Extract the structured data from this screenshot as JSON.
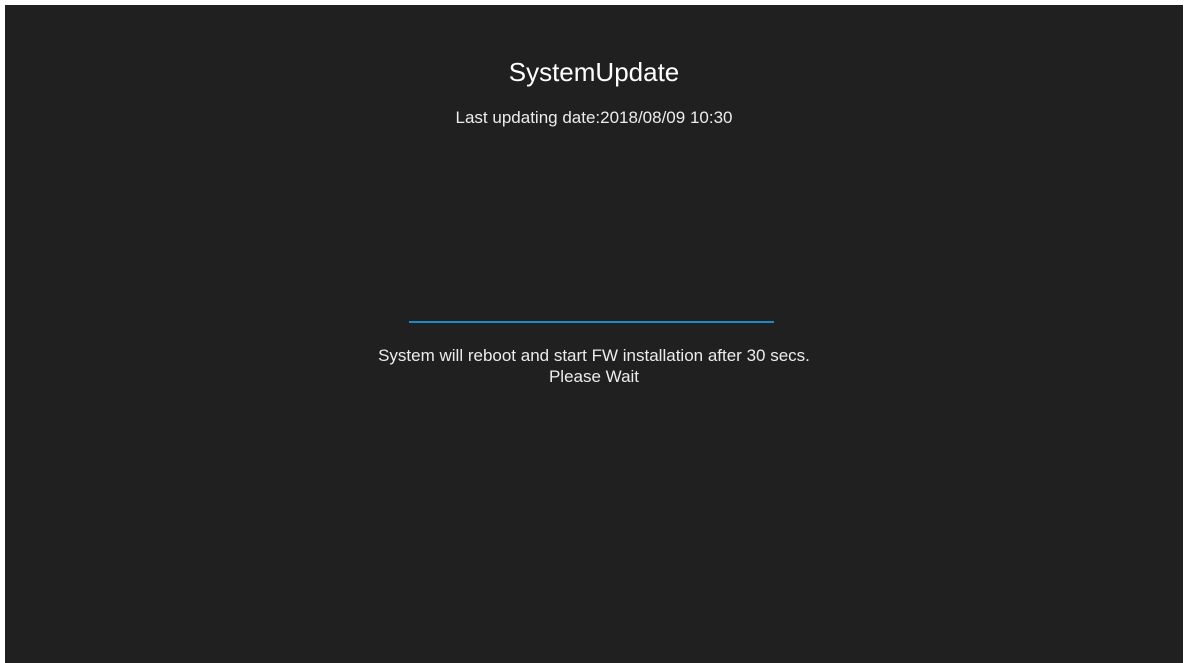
{
  "header": {
    "title": "SystemUpdate",
    "last_updating": "Last updating date:2018/08/09 10:30"
  },
  "progress": {
    "value_percent": 100,
    "color": "#1e88c8"
  },
  "message": {
    "line1": "System will reboot and start FW installation after 30 secs.",
    "line2": "Please Wait"
  },
  "colors": {
    "background": "#202020",
    "text": "#ececec"
  }
}
